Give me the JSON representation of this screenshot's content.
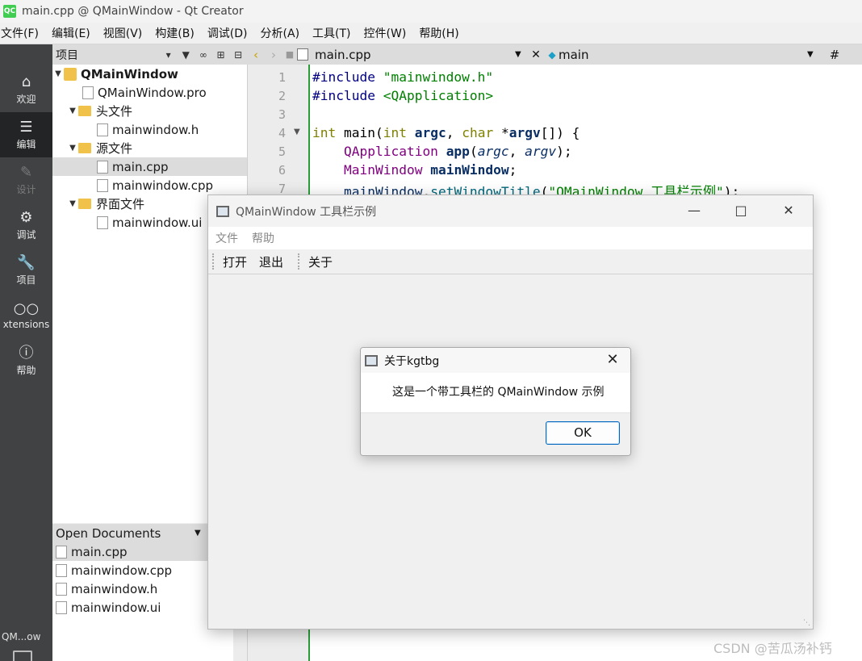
{
  "window": {
    "title": "main.cpp @ QMainWindow - Qt Creator"
  },
  "menubar": [
    "文件(F)",
    "编辑(E)",
    "视图(V)",
    "构建(B)",
    "调试(D)",
    "分析(A)",
    "工具(T)",
    "控件(W)",
    "帮助(H)"
  ],
  "modes": [
    {
      "label": "欢迎",
      "icon": "home-icon"
    },
    {
      "label": "编辑",
      "icon": "edit-icon"
    },
    {
      "label": "设计",
      "icon": "design-icon"
    },
    {
      "label": "调试",
      "icon": "bug-icon"
    },
    {
      "label": "项目",
      "icon": "wrench-icon"
    },
    {
      "label": "xtensions",
      "icon": "extensions-icon"
    },
    {
      "label": "帮助",
      "icon": "help-icon"
    }
  ],
  "target_label": "QM...ow",
  "project_panel": {
    "header": "项目",
    "tree": [
      {
        "label": "QMainWindow",
        "kind": "root"
      },
      {
        "label": "QMainWindow.pro",
        "kind": "pro"
      },
      {
        "label": "头文件",
        "kind": "folder"
      },
      {
        "label": "mainwindow.h",
        "kind": "h"
      },
      {
        "label": "源文件",
        "kind": "folder"
      },
      {
        "label": "main.cpp",
        "kind": "cpp"
      },
      {
        "label": "mainwindow.cpp",
        "kind": "cpp"
      },
      {
        "label": "界面文件",
        "kind": "folder"
      },
      {
        "label": "mainwindow.ui",
        "kind": "ui"
      }
    ]
  },
  "open_documents": {
    "header": "Open Documents",
    "items": [
      "main.cpp",
      "mainwindow.cpp",
      "mainwindow.h",
      "mainwindow.ui"
    ]
  },
  "editor": {
    "file": "main.cpp",
    "symbol": "main",
    "hash": "#",
    "line_numbers": [
      "1",
      "2",
      "3",
      "4",
      "5",
      "6",
      "7"
    ],
    "code": {
      "l1_kw": "#include",
      "l1_str": " \"mainwindow.h\"",
      "l2_kw": "#include",
      "l2_str": " <QApplication>",
      "l4_a": "int",
      "l4_b": " main(",
      "l4_c": "int",
      "l4_d": "argc",
      "l4_e": "char",
      "l4_f": "*",
      "l4_g": "argv",
      "l4_h": "[]) {",
      "l5_type": "QApplication",
      "l5_var": "app",
      "l5_a1": "argc",
      "l5_a2": "argv",
      "l6_type": "MainWindow",
      "l6_var": "mainWindow",
      "l7_obj": "mainWindow",
      "l7_fn": "setWindowTitle",
      "l7_str": "\"QMainWindow 工具栏示例\""
    }
  },
  "app_window": {
    "title": "QMainWindow 工具栏示例",
    "menus": [
      "文件",
      "帮助"
    ],
    "toolbar": [
      "打开",
      "退出",
      "关于"
    ]
  },
  "dialog": {
    "title": "关于kgtbg",
    "message": "这是一个带工具栏的 QMainWindow 示例",
    "ok": "OK"
  },
  "watermark": "CSDN @苦瓜汤补钙"
}
